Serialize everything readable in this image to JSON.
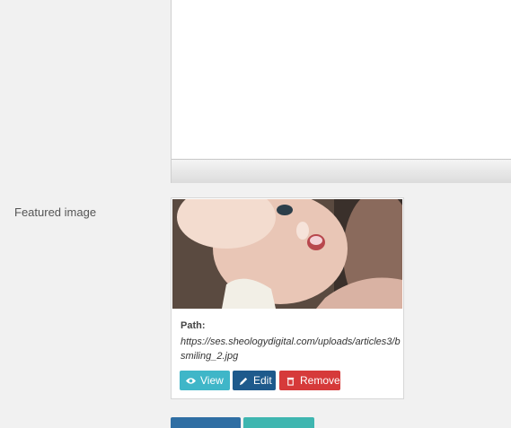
{
  "featured_image": {
    "label": "Featured image",
    "path_label": "Path:",
    "path_value": "https://ses.sheologydigital.com/uploads/articles3/b smiling_2.jpg",
    "buttons": {
      "view": "View",
      "edit": "Edit",
      "remove": "Remove"
    }
  },
  "colors": {
    "view": "#3fb6c8",
    "edit": "#1e5a8c",
    "remove": "#d63a3a"
  },
  "icons": {
    "view": "eye-icon",
    "edit": "pencil-icon",
    "remove": "trash-icon"
  }
}
